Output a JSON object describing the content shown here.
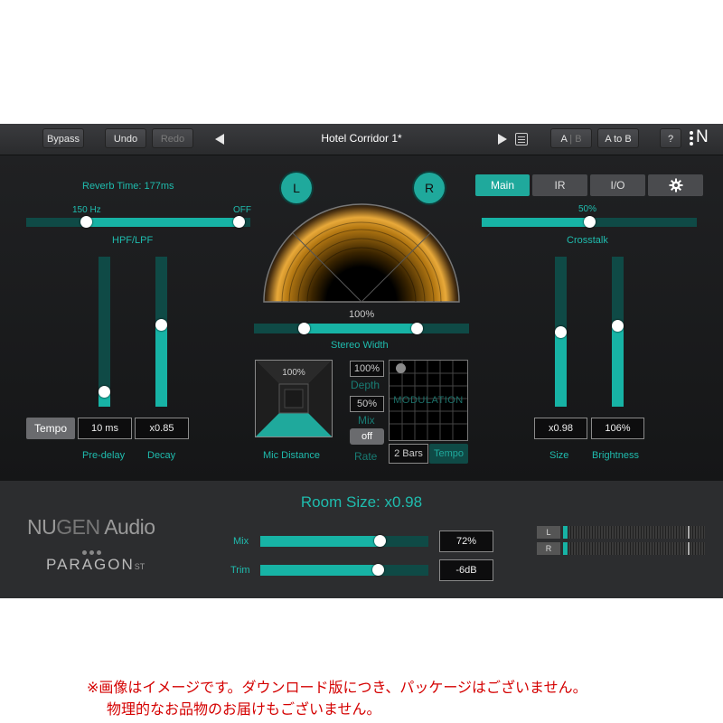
{
  "topbar": {
    "bypass": "Bypass",
    "undo": "Undo",
    "redo": "Redo",
    "preset_name": "Hotel Corridor 1*",
    "ab_a": "A",
    "ab_b": "B",
    "a_to_b": "A to B",
    "help": "?",
    "logo_letter": "N"
  },
  "left": {
    "reverb_time": "Reverb Time: 177ms",
    "hpf_value": "150 Hz",
    "lpf_value": "OFF",
    "hpf_lpf_label": "HPF/LPF",
    "tempo_button": "Tempo",
    "predelay_value": "10 ms",
    "decay_value": "x0.85",
    "predelay_label": "Pre-delay",
    "decay_label": "Decay",
    "predelay_level": 0.1,
    "decay_level": 0.55
  },
  "center": {
    "l_button": "L",
    "r_button": "R",
    "stereo_width_value": "100%",
    "stereo_width_label": "Stereo Width",
    "mic_value": "100%",
    "mic_label": "Mic Distance",
    "depth_value": "100%",
    "depth_label": "Depth",
    "mix_value": "50%",
    "mix_label": "Mix",
    "off_button": "off",
    "rate_label": "Rate",
    "modulation_label": "MODULATION",
    "bars_value": "2 Bars",
    "tempo_label": "Tempo",
    "room_size": "Room Size: x0.98"
  },
  "right": {
    "tab_main": "Main",
    "tab_ir": "IR",
    "tab_io": "I/O",
    "crosstalk_value": "50%",
    "crosstalk_label": "Crosstalk",
    "size_value": "x0.98",
    "brightness_value": "106%",
    "size_label": "Size",
    "brightness_label": "Brightness",
    "size_level": 0.5,
    "brightness_level": 0.54
  },
  "bottom": {
    "brand": "NUGEN Audio",
    "brand_nu": "NU",
    "brand_gen": "GEN",
    "brand_audio": " Audio",
    "product": "PARAGON",
    "product_suffix": "ST",
    "mix_label": "Mix",
    "mix_value": "72%",
    "trim_label": "Trim",
    "trim_value": "-6dB",
    "meter_l": "L",
    "meter_r": "R"
  },
  "notice": {
    "line1": "※画像はイメージです。ダウンロード版につき、パッケージはございません。",
    "line2": "物理的なお品物のお届けもございません。"
  },
  "colors": {
    "accent": "#1fbcae",
    "notice": "#d40000"
  }
}
